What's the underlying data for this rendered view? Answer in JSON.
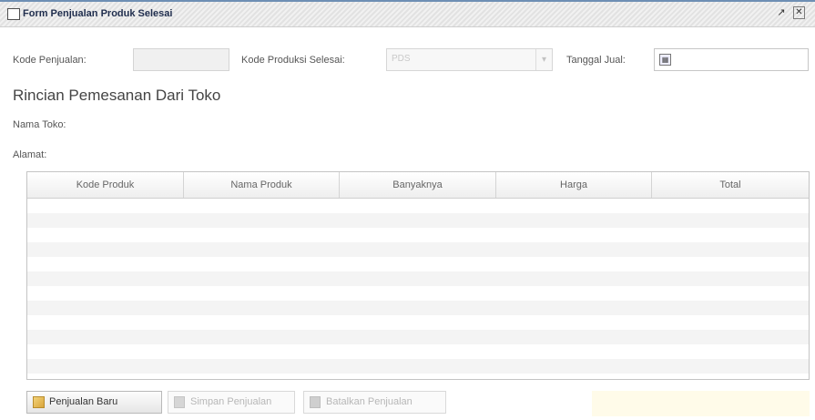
{
  "window": {
    "title": "Form Penjualan Produk Selesai"
  },
  "form": {
    "kode_penjualan_label": "Kode Penjualan:",
    "kode_penjualan_value": "",
    "kode_produksi_label": "Kode Produksi Selesai:",
    "kode_produksi_value": "PDS",
    "tanggal_jual_label": "Tanggal Jual:",
    "tanggal_jual_value": ""
  },
  "section": {
    "title": "Rincian Pemesanan Dari Toko",
    "nama_toko_label": "Nama Toko:",
    "alamat_label": "Alamat:"
  },
  "grid": {
    "columns": [
      "Kode Produk",
      "Nama Produk",
      "Banyaknya",
      "Harga",
      "Total"
    ],
    "rows": []
  },
  "buttons": {
    "new_sale": "Penjualan Baru",
    "save_sale": "Simpan Penjualan",
    "cancel_sale": "Batalkan Penjualan"
  },
  "icons": {
    "window": "form-icon",
    "minimize": "minimize-icon",
    "close": "close-icon",
    "calendar": "calendar-icon",
    "dropdown": "chevron-down-icon",
    "new": "new-document-icon",
    "save": "save-icon",
    "cancel": "cancel-icon"
  }
}
